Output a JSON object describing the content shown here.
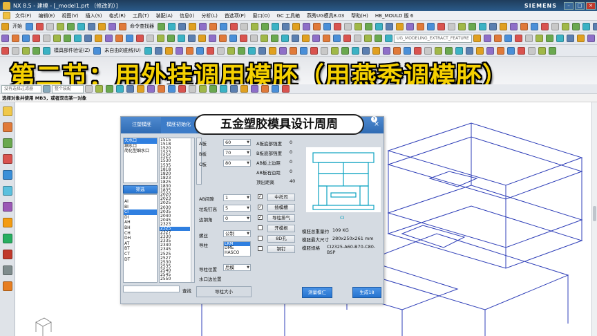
{
  "window": {
    "title": "NX 8.5 - 建模 - [_model1.prt （修改的）]",
    "brand": "SIEMENS"
  },
  "menubar": [
    "文件(F)",
    "编辑(E)",
    "视图(V)",
    "插入(S)",
    "格式(R)",
    "工具(T)",
    "装配(A)",
    "信息(I)",
    "分析(L)",
    "首选项(P)",
    "窗口(O)",
    "GC 工具箱",
    "燕秀UG模具8.03",
    "帮助(H)",
    "HB_MOULD 版 6"
  ],
  "toolbar1": {
    "start": "开始",
    "command_finder": "命令查找器"
  },
  "toolbar2": {
    "feature_combo": "UG_MODELING_EXTRACT_FEATURE"
  },
  "toolbar3": {
    "mold_check": "模具部件验证(Z)",
    "unrelated_curve": "未自由的曲线(U)"
  },
  "banner": "第二节：用外挂调用模胚（用燕秀调模胚）",
  "selection_bar": {
    "filter": "没有选择过滤器",
    "scope": "整个装配"
  },
  "cue_line": "选择对象并使用 MB3，或者双击某一对象",
  "dialog": {
    "tabs": {
      "tab1": "注塑模胚",
      "tab2": "模胚初始化"
    },
    "title": "五金塑胶模具设计周周",
    "left_list": [
      "大水口",
      "细水口",
      "简化型细水口"
    ],
    "left_selected": 0,
    "filter_button": "筛选",
    "type_list": [
      "AI",
      "BI",
      "CI",
      "DI",
      "AH",
      "BH",
      "CH",
      "DH",
      "AT",
      "BT",
      "CT",
      "DT"
    ],
    "type_selected": 2,
    "size_list": [
      "1515",
      "1518",
      "1520",
      "1523",
      "1525",
      "1530",
      "1535",
      "1818",
      "1820",
      "1823",
      "1825",
      "1830",
      "1835",
      "2020",
      "2023",
      "2025",
      "2030",
      "2035",
      "2040",
      "2045",
      "2323",
      "2325",
      "2327",
      "2330",
      "2335",
      "2340",
      "2345",
      "2525",
      "2527",
      "2530",
      "2535",
      "2540",
      "2545",
      "2550"
    ],
    "size_selected": 21,
    "search_button": "查找",
    "plates": [
      {
        "label": "A板",
        "value": "60"
      },
      {
        "label": "B板",
        "value": "70"
      },
      {
        "label": "C板",
        "value": "80"
      }
    ],
    "wall_params": [
      {
        "label": "A板底部强度",
        "value": "0"
      },
      {
        "label": "B板底部强度",
        "value": "0"
      },
      {
        "label": "AB板上边距",
        "value": "0"
      },
      {
        "label": "AB板右边距",
        "value": "0"
      },
      {
        "label": "顶出距离",
        "value": "40"
      }
    ],
    "gap_params": [
      {
        "label": "AB间隙",
        "value": "1"
      },
      {
        "label": "垃圾钉高",
        "value": "5"
      },
      {
        "label": "边钢角",
        "value": "0"
      }
    ],
    "options": [
      {
        "label": "中托司",
        "checked": true
      },
      {
        "label": "插模槽",
        "checked": true
      },
      {
        "label": "导柱排气",
        "checked": true
      },
      {
        "label": "开模根",
        "checked": false
      },
      {
        "label": "8D孔",
        "checked": false
      },
      {
        "label": "钢钉",
        "checked": false
      }
    ],
    "screw": {
      "label": "螺丝",
      "value": "公制"
    },
    "guide": {
      "label": "导柱",
      "options": [
        "LKM",
        "DME",
        "HASCO"
      ],
      "selected": 0
    },
    "guide_pos": {
      "label": "导柱位置",
      "value": "后模"
    },
    "water_pos_label": "水口边位置",
    "guide_size_button": "导柱大小",
    "preview_label": "CI",
    "info": [
      {
        "label": "模胚总重量约",
        "value": "109 KG"
      },
      {
        "label": "模胚最大尺寸",
        "value": "280x250x261 mm"
      },
      {
        "label": "模胚规格",
        "value": "CI2325-A60-B70-C80-BSP"
      }
    ],
    "measure_button": "测量模仁",
    "generate_button": "生成18"
  },
  "colors": {
    "titlebar": "#1f3d5c",
    "banner_text": "#f5d000",
    "dialog_header": "#2f6bb3",
    "selection": "#2f7fe0",
    "preview_cyan": "#0aa2c0",
    "model_lines": "#2f3fb8"
  }
}
